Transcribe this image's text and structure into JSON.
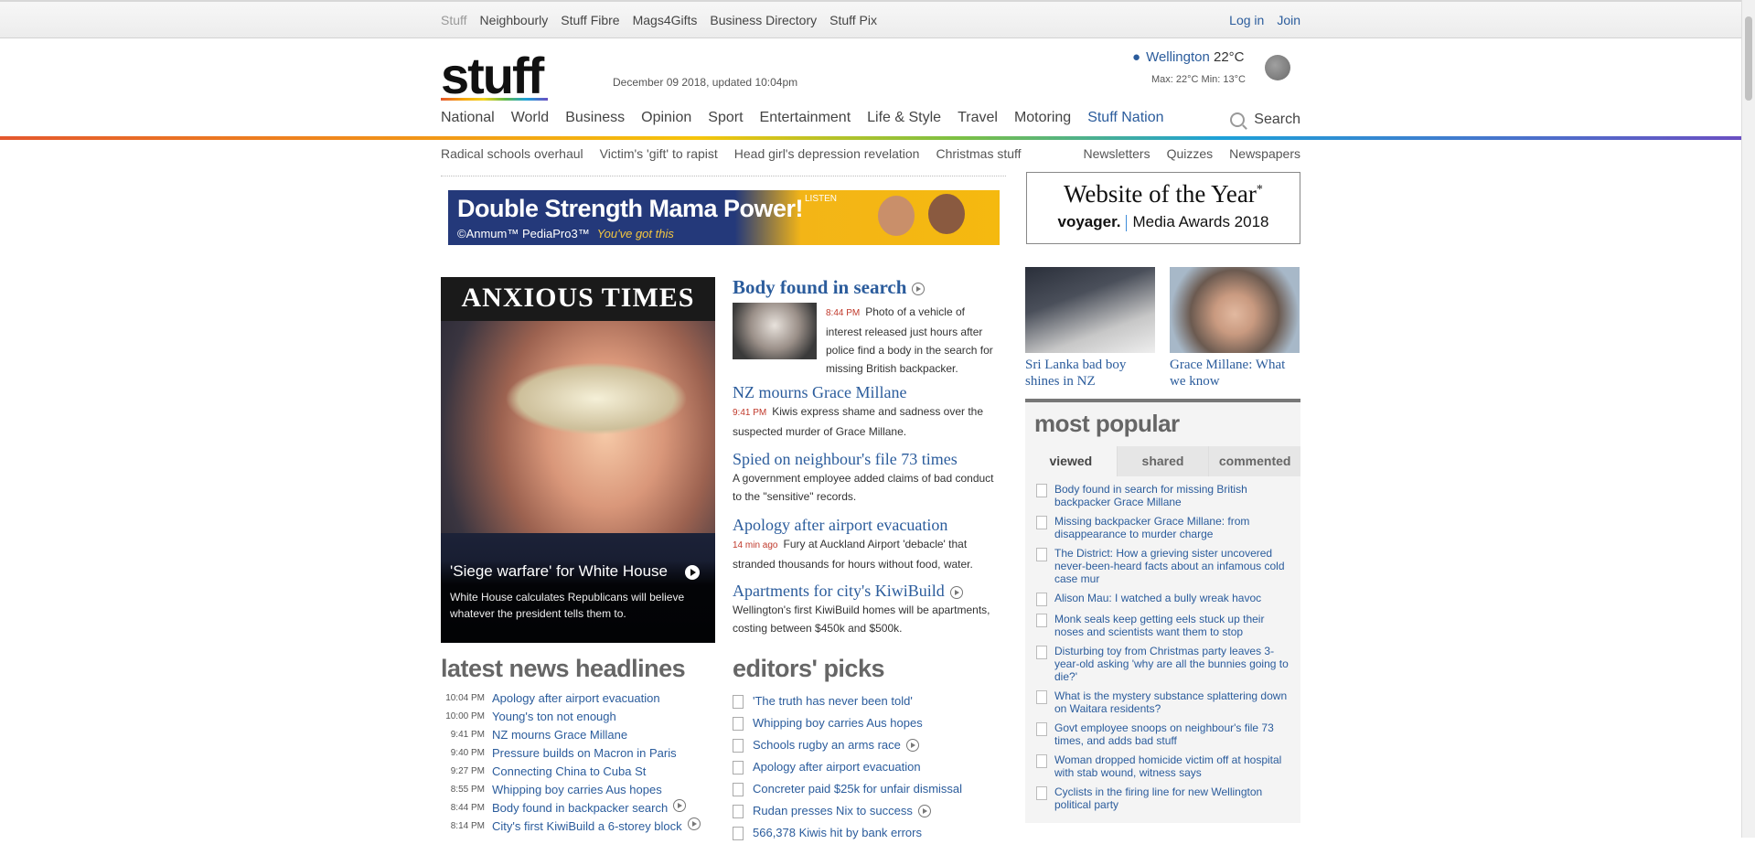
{
  "topbar": {
    "links": [
      "Stuff",
      "Neighbourly",
      "Stuff Fibre",
      "Mags4Gifts",
      "Business Directory",
      "Stuff Pix"
    ],
    "login": "Log in",
    "join": "Join"
  },
  "header": {
    "logo": "stuff",
    "dateline": "December 09 2018, updated 10:04pm",
    "weather": {
      "city": "Wellington",
      "temp": "22°C",
      "range": "Max: 22°C  Min: 13°C"
    }
  },
  "nav": {
    "items": [
      "National",
      "World",
      "Business",
      "Opinion",
      "Sport",
      "Entertainment",
      "Life & Style",
      "Travel",
      "Motoring",
      "Stuff Nation"
    ],
    "search": "Search"
  },
  "subnav": {
    "left": [
      "Radical schools overhaul",
      "Victim's 'gift' to rapist",
      "Head girl's depression revelation",
      "Christmas stuff"
    ],
    "right": [
      "Newsletters",
      "Quizzes",
      "Newspapers"
    ]
  },
  "ad": {
    "headline": "Double Strength Mama Power!",
    "brand": "©Anmum™ PediaPro3™",
    "tagline": "You've got this",
    "listen": "LISTEN"
  },
  "award": {
    "title": "Website of the Year",
    "mark": "*",
    "sponsor": "voyager.",
    "event": "Media Awards 2018"
  },
  "lead": {
    "kicker": "ANXIOUS TIMES",
    "title": "'Siege warfare' for White House",
    "text": "White House calculates Republicans will believe whatever the president tells them to."
  },
  "stories": [
    {
      "title": "Body found in search",
      "time": "8:44 PM",
      "text": "Photo of a vehicle of interest released just hours after police find a body in the search for missing British backpacker."
    },
    {
      "title": "NZ mourns Grace Millane",
      "time": "9:41 PM",
      "text": "Kiwis express shame and sadness over the suspected murder of Grace Millane."
    },
    {
      "title": "Spied on neighbour's file 73 times",
      "time": "",
      "text": "A government employee added claims of bad conduct to the \"sensitive\" records."
    },
    {
      "title": "Apology after airport evacuation",
      "time": "14 min ago",
      "text": "Fury at Auckland Airport 'debacle' that stranded thousands for hours without food, water."
    },
    {
      "title": "Apartments for city's KiwiBuild",
      "time": "",
      "text": "Wellington's first KiwiBuild homes will be apartments, costing between $450k and $500k."
    }
  ],
  "rail": [
    {
      "caption": "Sri Lanka bad boy shines in NZ"
    },
    {
      "caption": "Grace Millane: What we know"
    }
  ],
  "popular": {
    "title": "most popular",
    "tabs": [
      "viewed",
      "shared",
      "commented"
    ],
    "items": [
      "Body found in search for missing British backpacker Grace Millane",
      "Missing backpacker Grace Millane: from disappearance to murder charge",
      "The District: How a grieving sister uncovered never-been-heard facts about an infamous cold case mur",
      "Alison Mau: I watched a bully wreak havoc",
      "Monk seals keep getting eels stuck up their noses and scientists want them to stop",
      "Disturbing toy from Christmas party leaves 3-year-old asking 'why are all the bunnies going to die?'",
      "What is the mystery substance splattering down on Waitara residents?",
      "Govt employee snoops on neighbour's file 73 times, and adds bad stuff",
      "Woman dropped homicide victim off at hospital with stab wound, witness says",
      "Cyclists in the firing line for new Wellington political party"
    ]
  },
  "latest": {
    "title": "latest news headlines",
    "rows": [
      {
        "time": "10:04 PM",
        "text": "Apology after airport evacuation"
      },
      {
        "time": "10:00 PM",
        "text": "Young's ton not enough"
      },
      {
        "time": "9:41 PM",
        "text": "NZ mourns Grace Millane"
      },
      {
        "time": "9:40 PM",
        "text": "Pressure builds on Macron in Paris"
      },
      {
        "time": "9:27 PM",
        "text": "Connecting China to Cuba St"
      },
      {
        "time": "8:55 PM",
        "text": "Whipping boy carries Aus hopes"
      },
      {
        "time": "8:44 PM",
        "text": "Body found in backpacker search"
      },
      {
        "time": "8:14 PM",
        "text": "City's first KiwiBuild a 6-storey block"
      }
    ]
  },
  "picks": {
    "title": "editors' picks",
    "rows": [
      "'The truth has never been told'",
      "Whipping boy carries Aus hopes",
      "Schools rugby an arms race",
      "Apology after airport evacuation",
      "Concreter paid $25k for unfair dismissal",
      "Rudan presses Nix to success",
      "566,378 Kiwis hit by bank errors"
    ]
  }
}
